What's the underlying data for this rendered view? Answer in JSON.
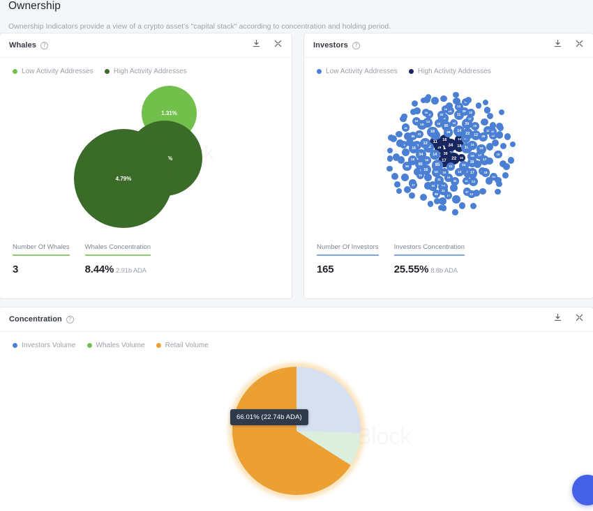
{
  "page": {
    "title": "Ownership",
    "subtitle": "Ownership Indicators provide a view of a crypto asset's \"capital stack\" according to concentration and holding period."
  },
  "icons": {
    "info": "?",
    "download": "download-icon",
    "expand": "expand-icon"
  },
  "watermark": "IntoTheBlock",
  "colors": {
    "whales_low": "#72bf4c",
    "whales_high": "#3b6b28",
    "investors_low": "#4a7fd4",
    "investors_high": "#17265e",
    "retail": "#eca033",
    "pie_investors": "#d6e0f0",
    "pie_whales": "#dceedd",
    "tooltip_bg": "#2f3b4d"
  },
  "whales_card": {
    "title": "Whales",
    "legend": [
      {
        "label": "Low Activity Addresses",
        "color": "#72bf4c"
      },
      {
        "label": "High Activity Addresses",
        "color": "#3b6b28"
      }
    ],
    "stats": [
      {
        "label": "Number Of Whales",
        "value": "3",
        "sub": "",
        "rule": "#8fc96f"
      },
      {
        "label": "Whales Concentration",
        "value": "8.44%",
        "sub": "2.91b ADA",
        "rule": "#8fc96f"
      }
    ]
  },
  "investors_card": {
    "title": "Investors",
    "legend": [
      {
        "label": "Low Activity Addresses",
        "color": "#4a7fd4"
      },
      {
        "label": "High Activity Addresses",
        "color": "#17265e"
      }
    ],
    "stats": [
      {
        "label": "Number Of Investors",
        "value": "165",
        "sub": "",
        "rule": "#7ea5e0"
      },
      {
        "label": "Investors Concentration",
        "value": "25.55%",
        "sub": "8.8b ADA",
        "rule": "#7ea5e0"
      }
    ]
  },
  "concentration_card": {
    "title": "Concentration",
    "legend": [
      {
        "label": "Investors Volume",
        "color": "#4a7fd4"
      },
      {
        "label": "Whales Volume",
        "color": "#72bf4c"
      },
      {
        "label": "Retail Volume",
        "color": "#eca033"
      }
    ],
    "tooltip": "66.01% (22.74b ADA)"
  },
  "chart_data": [
    {
      "type": "bubble",
      "title": "Whales",
      "unit": "percent",
      "legend": [
        "Low Activity Addresses",
        "High Activity Addresses"
      ],
      "bubbles": [
        {
          "label": "4.79%",
          "value": 4.79,
          "group": "High Activity Addresses",
          "color": "#3b6b28"
        },
        {
          "label": "2.34%",
          "value": 2.34,
          "group": "High Activity Addresses",
          "color": "#3b6b28"
        },
        {
          "label": "1.31%",
          "value": 1.31,
          "group": "Low Activity Addresses",
          "color": "#72bf4c"
        }
      ],
      "number_of_whales": 3,
      "whales_concentration_pct": 8.44,
      "whales_concentration_amount": "2.91b ADA"
    },
    {
      "type": "bubble",
      "title": "Investors",
      "unit": "percent",
      "legend": [
        "Low Activity Addresses",
        "High Activity Addresses"
      ],
      "number_of_investors": 165,
      "investors_concentration_pct": 25.55,
      "investors_concentration_amount": "8.8b ADA",
      "note": "165 packed bubbles; majority low-activity (medium blue), a small cluster of high-activity (dark navy) near the centre. Largest labelled bubbles include 0.85%, 0.39%, 0.34%, 0.22%, 0.19%, 0.18%, 0.17%, 0.16%."
    },
    {
      "type": "pie",
      "title": "Concentration",
      "categories": [
        "Investors Volume",
        "Whales Volume",
        "Retail Volume"
      ],
      "values": [
        25.55,
        8.44,
        66.01
      ],
      "labels": [
        "25.55%",
        "8.44%",
        "66.01%"
      ],
      "amounts": [
        "8.8b ADA",
        "2.91b ADA",
        "22.74b ADA"
      ],
      "colors": [
        "#d6e0f0",
        "#dceedd",
        "#eca033"
      ],
      "highlighted_slice": "Retail Volume",
      "tooltip": "66.01% (22.74b ADA)",
      "legend_position": "top-left"
    }
  ]
}
